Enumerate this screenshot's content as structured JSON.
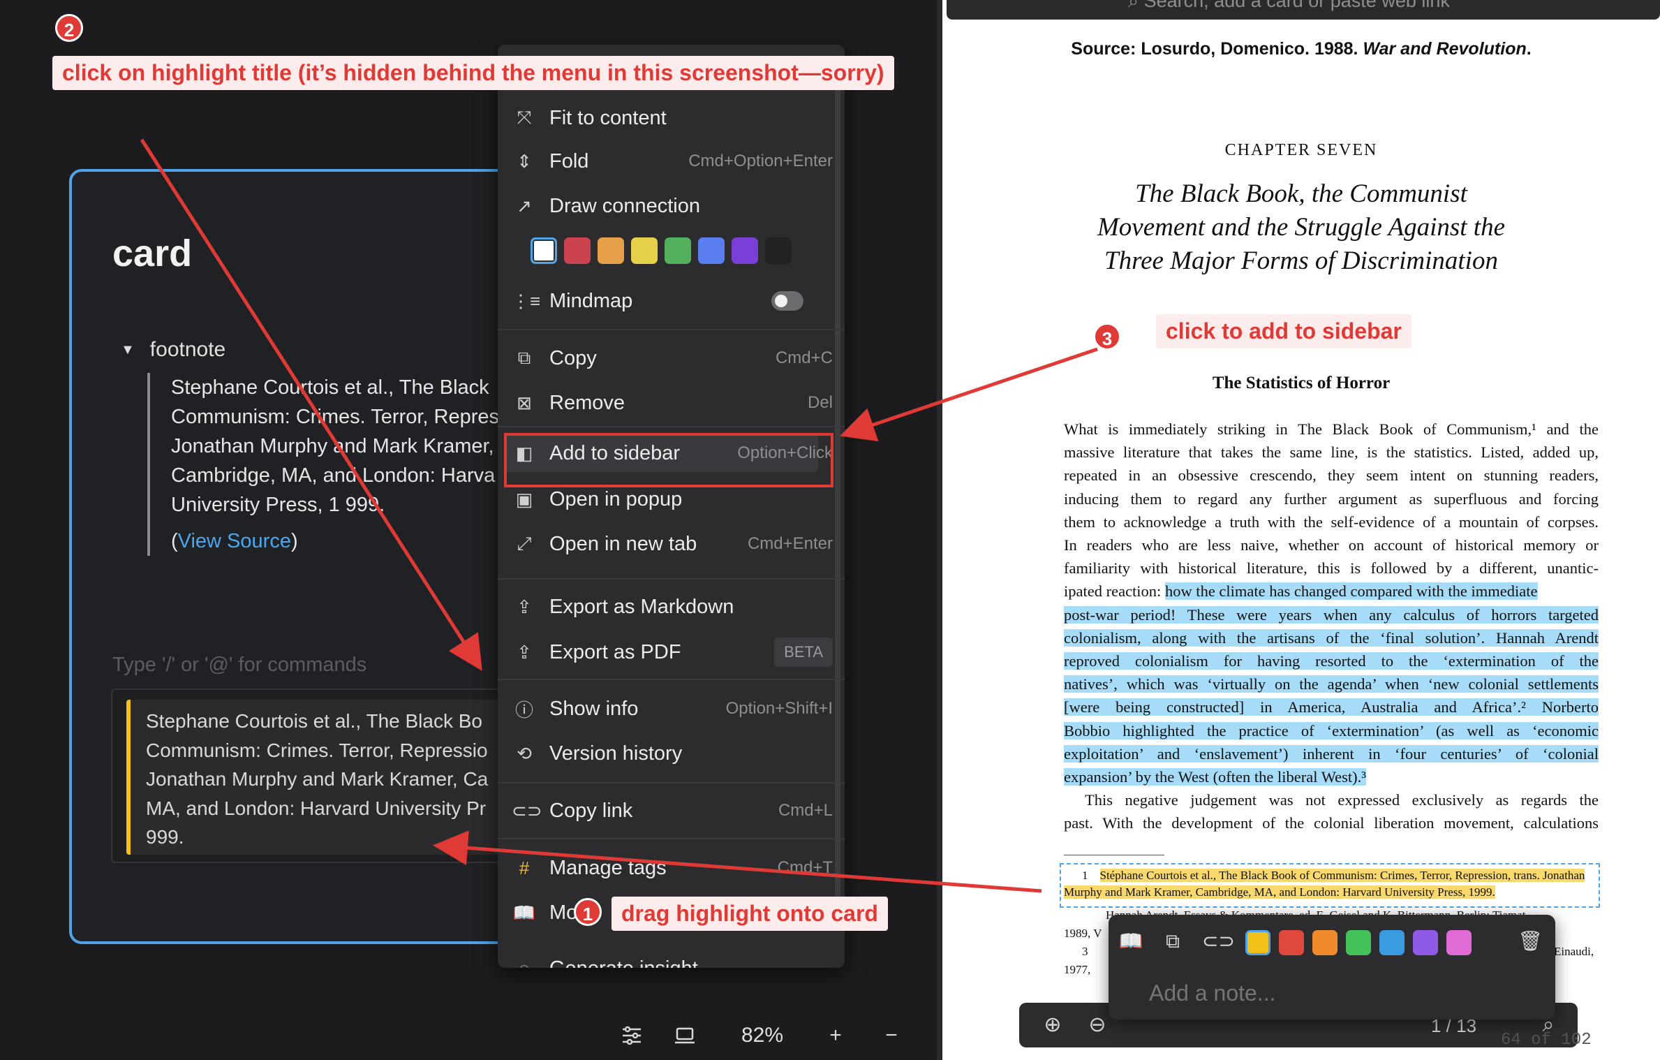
{
  "search": {
    "placeholder": "Search, add a card or paste web link"
  },
  "card": {
    "title": "card",
    "footnote_label": "footnote",
    "footnote_lines": [
      "Stephane Courtois et al., The Black",
      "Communism: Crimes. Terror, Repres",
      "Jonathan Murphy and Mark Kramer,",
      "Cambridge, MA, and London: Harva",
      "University Press, 1 999."
    ],
    "view_source_prefix": "(",
    "view_source": "View Source",
    "view_source_suffix": ")",
    "command_placeholder": "Type '/' or '@' for commands",
    "quote_lines": [
      "Stephane Courtois et al., The Black Bo",
      "Communism: Crimes. Terror, Repressio",
      "Jonathan Murphy and Mark Kramer, Ca",
      "MA, and London: Harvard University Pr",
      "999."
    ]
  },
  "toolbar": {
    "zoom": "82%"
  },
  "menu": {
    "items": [
      {
        "icon": "fit-to-content-icon",
        "label": "Fit to content",
        "shortcut": ""
      },
      {
        "icon": "fold-icon",
        "label": "Fold",
        "shortcut": "Cmd+Option+Enter"
      },
      {
        "icon": "draw-connection-icon",
        "label": "Draw connection",
        "shortcut": ""
      },
      {
        "icon": "mindmap-icon",
        "label": "Mindmap",
        "shortcut": ""
      },
      {
        "icon": "copy-icon",
        "label": "Copy",
        "shortcut": "Cmd+C"
      },
      {
        "icon": "remove-icon",
        "label": "Remove",
        "shortcut": "Del"
      },
      {
        "icon": "sidebar-icon",
        "label": "Add to sidebar",
        "shortcut": "Option+Click"
      },
      {
        "icon": "popup-icon",
        "label": "Open in popup",
        "shortcut": ""
      },
      {
        "icon": "new-tab-icon",
        "label": "Open in new tab",
        "shortcut": "Cmd+Enter"
      },
      {
        "icon": "export-icon",
        "label": "Export as Markdown",
        "shortcut": ""
      },
      {
        "icon": "export-pdf-icon",
        "label": "Export as PDF",
        "shortcut": "BETA"
      },
      {
        "icon": "info-icon",
        "label": "Show info",
        "shortcut": "Option+Shift+I"
      },
      {
        "icon": "history-icon",
        "label": "Version history",
        "shortcut": ""
      },
      {
        "icon": "link-icon",
        "label": "Copy link",
        "shortcut": "Cmd+L"
      },
      {
        "icon": "hashtag-icon",
        "label": "Manage tags",
        "shortcut": "Cmd+T"
      },
      {
        "icon": "book-icon",
        "label": "Mo",
        "shortcut": ""
      },
      {
        "icon": "insight-icon",
        "label": "Generate insight",
        "shortcut": ""
      }
    ],
    "colors": [
      "#ffffff",
      "#c9424d",
      "#e6a04a",
      "#e6d14a",
      "#53b05c",
      "#5a7ef0",
      "#7a3fd6",
      "#222224"
    ]
  },
  "pdf": {
    "source_prefix": "Source: Losurdo, Domenico. 1988. ",
    "source_title": "War and Revolution",
    "source_suffix": ".",
    "chapter_label": "CHAPTER SEVEN",
    "chapter_title_lines": [
      "The Black Book, the Communist",
      "Movement and the Struggle Against the",
      "Three Major Forms of Discrimination"
    ],
    "section_title": "The Statistics of Horror",
    "body_lines": [
      "What is immediately striking in The Black Book of Communism,¹ and the",
      "massive literature that takes the same line, is the statistics. Listed, added up,",
      "repeated in an obsessive crescendo, they seem intent on stunning readers,",
      "inducing them to regard any further argument as superfluous and forcing",
      "them to acknowledge a truth with the self-evidence of a mountain of corpses.",
      "In readers who are less naive, whether on account of historical memory or",
      "familiarity with historical literature, this is followed by a different, unantic-",
      "ipated reaction: ",
      "how the climate has changed compared with the immediate",
      "post-war period! These were years when any calculus of horrors targeted",
      "colonialism, along with the artisans of the ‘final solution’. Hannah Arendt",
      "reproved colonialism for having resorted to the ‘extermination of the",
      "natives’, which was ‘virtually on the agenda’ when ‘new colonial settlements",
      "[were being constructed] in America, Australia and Africa’.² Norberto",
      "Bobbio highlighted the practice of ‘extermination’ (as well as ‘economic",
      "exploitation’ and ‘enslavement’) inherent in ‘four centuries’ of ‘colonial",
      "expansion’ by the West (often the liberal West).³",
      "This negative judgement was not expressed exclusively as regards the",
      "past. With the development of the colonial liberation movement, calculations"
    ],
    "footnote1_lines": [
      "Stéphane Courtois et al., The Black Book of Communism: Crimes, Terror, Repression, trans. Jonathan",
      "Murphy and Mark Kramer, Cambridge, MA, and London: Harvard University Press, 1999."
    ],
    "footnote1_num": "1",
    "footnote_rest": [
      "Hannah Arendt, Essays & Kommentare, ed. E. Geisel and K. Bittermann, Berlin: Tiamat,",
      "1989, V",
      "3",
      "Einaudi,",
      "1977,"
    ],
    "note_placeholder": "Add a note...",
    "page_indicator": "1 / 13",
    "page_count": "64 of 102",
    "highlight_colors": [
      "#f2c21b",
      "#e0483c",
      "#f08a2c",
      "#45c15a",
      "#3a9be0",
      "#8e5ae6",
      "#e06ad6"
    ]
  },
  "annotations": {
    "step1": "1",
    "step1_text": "drag highlight onto card",
    "step2": "2",
    "step2_text": "click on highlight title (it’s hidden behind the menu in this screenshot—sorry)",
    "step3": "3",
    "step3_text": "click to add to sidebar"
  }
}
